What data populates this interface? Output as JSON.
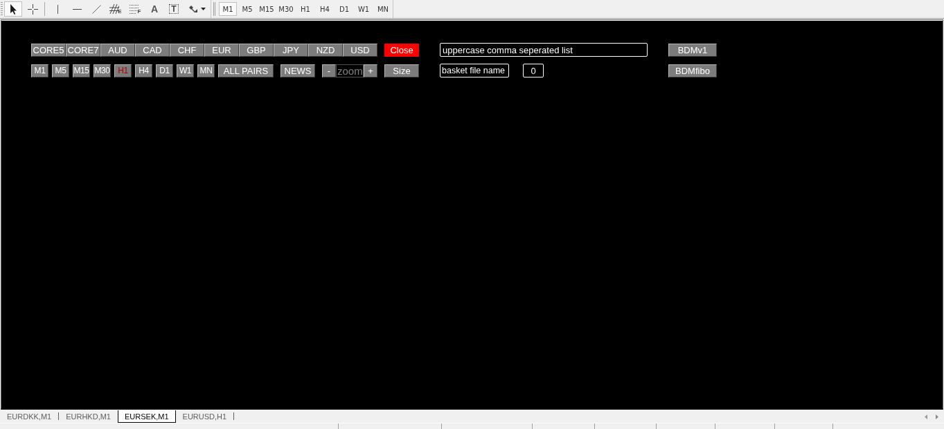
{
  "toolbar": {
    "tool_groups": [
      [
        {
          "kind": "pointer",
          "selected": true
        },
        {
          "kind": "crosshair",
          "selected": false
        }
      ],
      [
        {
          "kind": "vertical-line",
          "selected": false
        },
        {
          "kind": "horizontal-line",
          "selected": false
        },
        {
          "kind": "trend-line",
          "selected": false
        },
        {
          "kind": "fibo-fan",
          "label": "E",
          "selected": false
        },
        {
          "kind": "fibo-grid",
          "label": "F",
          "selected": false
        },
        {
          "kind": "text",
          "label": "A",
          "selected": false
        },
        {
          "kind": "text-label",
          "label": "T",
          "selected": false
        },
        {
          "kind": "arrows",
          "selected": false
        }
      ]
    ],
    "timeframes": [
      {
        "label": "M1",
        "selected": true
      },
      {
        "label": "M5",
        "selected": false
      },
      {
        "label": "M15",
        "selected": false
      },
      {
        "label": "M30",
        "selected": false
      },
      {
        "label": "H1",
        "selected": false
      },
      {
        "label": "H4",
        "selected": false
      },
      {
        "label": "D1",
        "selected": false
      },
      {
        "label": "W1",
        "selected": false
      },
      {
        "label": "MN",
        "selected": false
      }
    ]
  },
  "panel": {
    "symbol_buttons": [
      "CORE5",
      "CORE7",
      "AUD",
      "CAD",
      "CHF",
      "EUR",
      "GBP",
      "JPY",
      "NZD",
      "USD"
    ],
    "close_button": "Close",
    "symbol_list_field": {
      "value": "uppercase comma seperated list"
    },
    "timeframes": [
      {
        "label": "M1",
        "selected": false
      },
      {
        "label": "M5",
        "selected": false
      },
      {
        "label": "M15",
        "selected": false
      },
      {
        "label": "M30",
        "selected": false
      },
      {
        "label": "H1",
        "selected": true
      },
      {
        "label": "H4",
        "selected": false
      },
      {
        "label": "D1",
        "selected": false
      },
      {
        "label": "W1",
        "selected": false
      },
      {
        "label": "MN",
        "selected": false
      }
    ],
    "all_pairs_button": "ALL PAIRS",
    "news_button": "NEWS",
    "zoom": {
      "minus": "-",
      "placeholder": "zoom",
      "plus": "+"
    },
    "size_button": "Size",
    "basket_field": {
      "value": "basket file name"
    },
    "count_field": {
      "value": "0"
    },
    "indicator_buttons": [
      "BDMv1",
      "BDMfibo"
    ]
  },
  "chart_tabs": [
    {
      "label": "EURDKK,M1",
      "selected": false
    },
    {
      "label": "EURHKD,M1",
      "selected": false
    },
    {
      "label": "EURSEK,M1",
      "selected": true
    },
    {
      "label": "EURUSD,H1",
      "selected": false
    }
  ]
}
